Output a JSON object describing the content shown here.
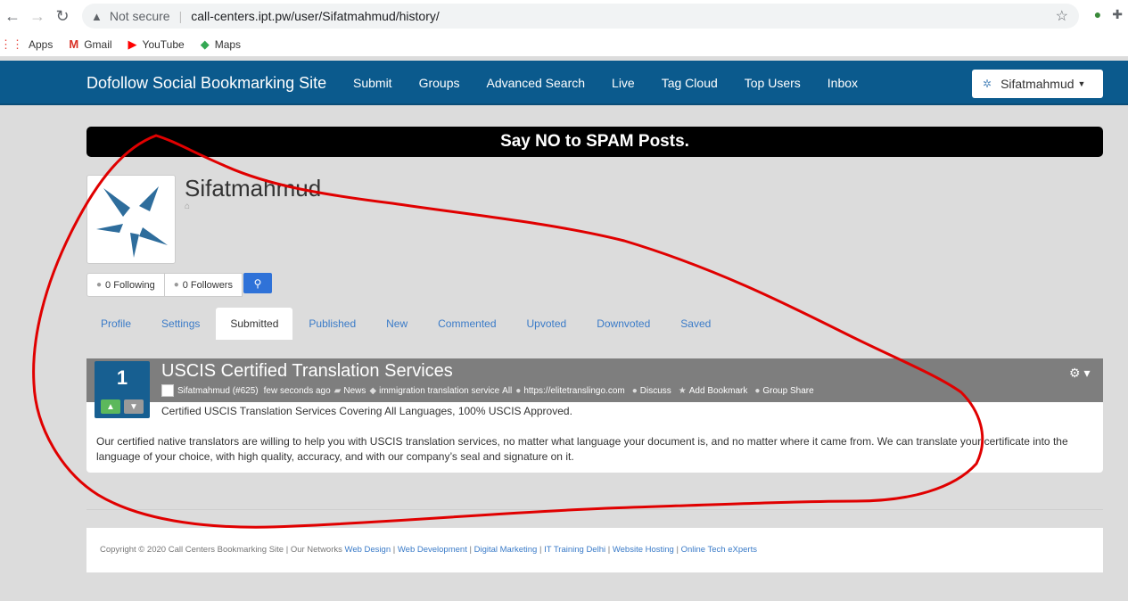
{
  "browser": {
    "security_label": "Not secure",
    "url": "call-centers.ipt.pw/user/Sifatmahmud/history/",
    "bookmarks": [
      {
        "label": "Apps",
        "icon": "apps-grid-icon"
      },
      {
        "label": "Gmail",
        "icon": "gmail-icon"
      },
      {
        "label": "YouTube",
        "icon": "youtube-icon"
      },
      {
        "label": "Maps",
        "icon": "maps-icon"
      }
    ]
  },
  "navbar": {
    "brand": "Dofollow Social Bookmarking Site",
    "links": [
      "Submit",
      "Groups",
      "Advanced Search",
      "Live",
      "Tag Cloud",
      "Top Users",
      "Inbox"
    ],
    "user": "Sifatmahmud"
  },
  "banner": {
    "text": "Say NO to SPAM Posts."
  },
  "profile": {
    "name": "Sifatmahmud",
    "following": "0 Following",
    "followers": "0 Followers"
  },
  "tabs": [
    "Profile",
    "Settings",
    "Submitted",
    "Published",
    "New",
    "Commented",
    "Upvoted",
    "Downvoted",
    "Saved"
  ],
  "active_tab": "Submitted",
  "story": {
    "votes": "1",
    "title": "USCIS Certified Translation Services",
    "author": "Sifatmahmud (#625)",
    "time": "few seconds ago",
    "category": "News",
    "tags": "immigration translation service",
    "group": "All",
    "link": "https://elitetranslingo.com",
    "discuss": "Discuss",
    "add_bookmark": "Add Bookmark",
    "group_share": "Group Share",
    "summary": "Certified USCIS Translation Services Covering All Languages, 100% USCIS Approved.",
    "description": "Our certified native translators are willing to help you with USCIS translation services, no matter what language your document is, and no matter where it came from. We can translate your certificate into the language of your choice, with high quality, accuracy, and with our company’s seal and signature on it."
  },
  "footer": {
    "copyright": "Copyright © 2020 Call Centers Bookmarking Site | Our Networks",
    "links": [
      "Web Design",
      "Web Development",
      "Digital Marketing",
      "IT Training Delhi",
      "Website Hosting",
      "Online Tech eXperts"
    ],
    "separator": "|"
  },
  "colors": {
    "navbar": "#0b5a8d",
    "vote_box": "#175f91",
    "annotation": "#e00000"
  }
}
